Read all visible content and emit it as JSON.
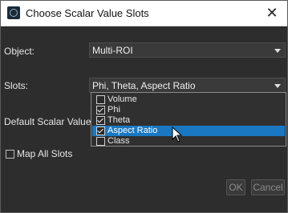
{
  "window": {
    "title": "Choose Scalar Value Slots",
    "close_glyph": "✕"
  },
  "fields": {
    "object_label": "Object:",
    "object_value": "Multi-ROI",
    "slots_label": "Slots:",
    "slots_value": "Phi, Theta, Aspect Ratio",
    "default_label": "Default Scalar Value:"
  },
  "slots_dropdown": {
    "options": [
      {
        "label": "Volume",
        "checked": false,
        "highlighted": false
      },
      {
        "label": "Phi",
        "checked": true,
        "highlighted": false
      },
      {
        "label": "Theta",
        "checked": true,
        "highlighted": false
      },
      {
        "label": "Aspect Ratio",
        "checked": true,
        "highlighted": true
      },
      {
        "label": "Class",
        "checked": false,
        "highlighted": false
      }
    ]
  },
  "map_all": {
    "label": "Map All Slots",
    "checked": false
  },
  "buttons": {
    "ok": "OK",
    "cancel": "Cancel"
  },
  "colors": {
    "highlight": "#1a78c2",
    "background": "#2d2d2d",
    "titlebar": "#ffffff"
  }
}
